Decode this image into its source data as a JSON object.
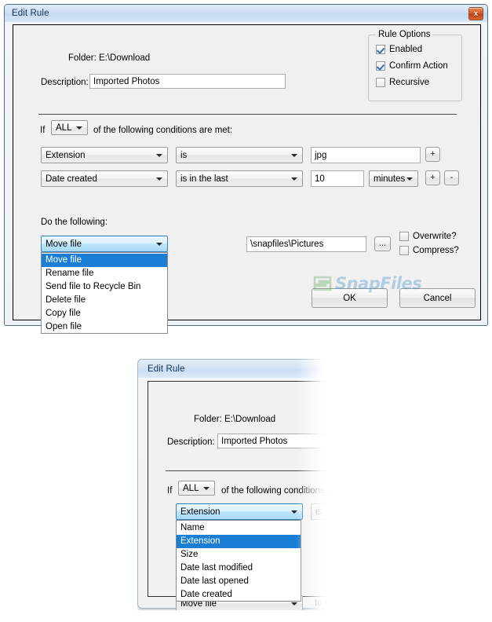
{
  "dialog1": {
    "title": "Edit Rule",
    "close_label": "x",
    "folder_label": "Folder: E:\\Download",
    "description_label": "Description:",
    "description_value": "Imported Photos",
    "rule_options": {
      "caption": "Rule Options",
      "items": [
        {
          "label": "Enabled",
          "checked": true
        },
        {
          "label": "Confirm Action",
          "checked": true
        },
        {
          "label": "Recursive",
          "checked": false
        }
      ]
    },
    "condition_intro_prefix": "If",
    "match_mode": "ALL",
    "condition_intro_suffix": "of the following conditions are met:",
    "conditions": [
      {
        "field": "Extension",
        "operator": "is",
        "value": "jpg",
        "unit": null,
        "add_button": "+",
        "remove_button": null
      },
      {
        "field": "Date created",
        "operator": "is in the last",
        "value": "10",
        "unit": "minutes",
        "add_button": "+",
        "remove_button": "-"
      }
    ],
    "action_label": "Do the following:",
    "action_selected": "Move file",
    "action_options": [
      "Move file",
      "Rename file",
      "Send file to Recycle Bin",
      "Delete file",
      "Copy file",
      "Open file"
    ],
    "destination_value": "\\snapfiles\\Pictures",
    "browse_button": "...",
    "overwrite": {
      "label": "Overwrite?",
      "checked": false
    },
    "compress": {
      "label": "Compress?",
      "checked": false
    },
    "ok_button": "OK",
    "cancel_button": "Cancel",
    "watermark_text": "SnapFiles"
  },
  "dialog2": {
    "title": "Edit Rule",
    "folder_label": "Folder: E:\\Download",
    "description_label": "Description:",
    "description_value": "Imported Photos",
    "condition_intro_prefix": "If",
    "match_mode": "ALL",
    "condition_intro_suffix": "of the following conditions are",
    "field_selected": "Extension",
    "operator_value": "is",
    "field_options": [
      "Name",
      "Extension",
      "Size",
      "Date last modified",
      "Date last opened",
      "Date created"
    ],
    "field_selected_index": 1,
    "action_behind": "Move file",
    "to_folder_label": "to folde"
  }
}
